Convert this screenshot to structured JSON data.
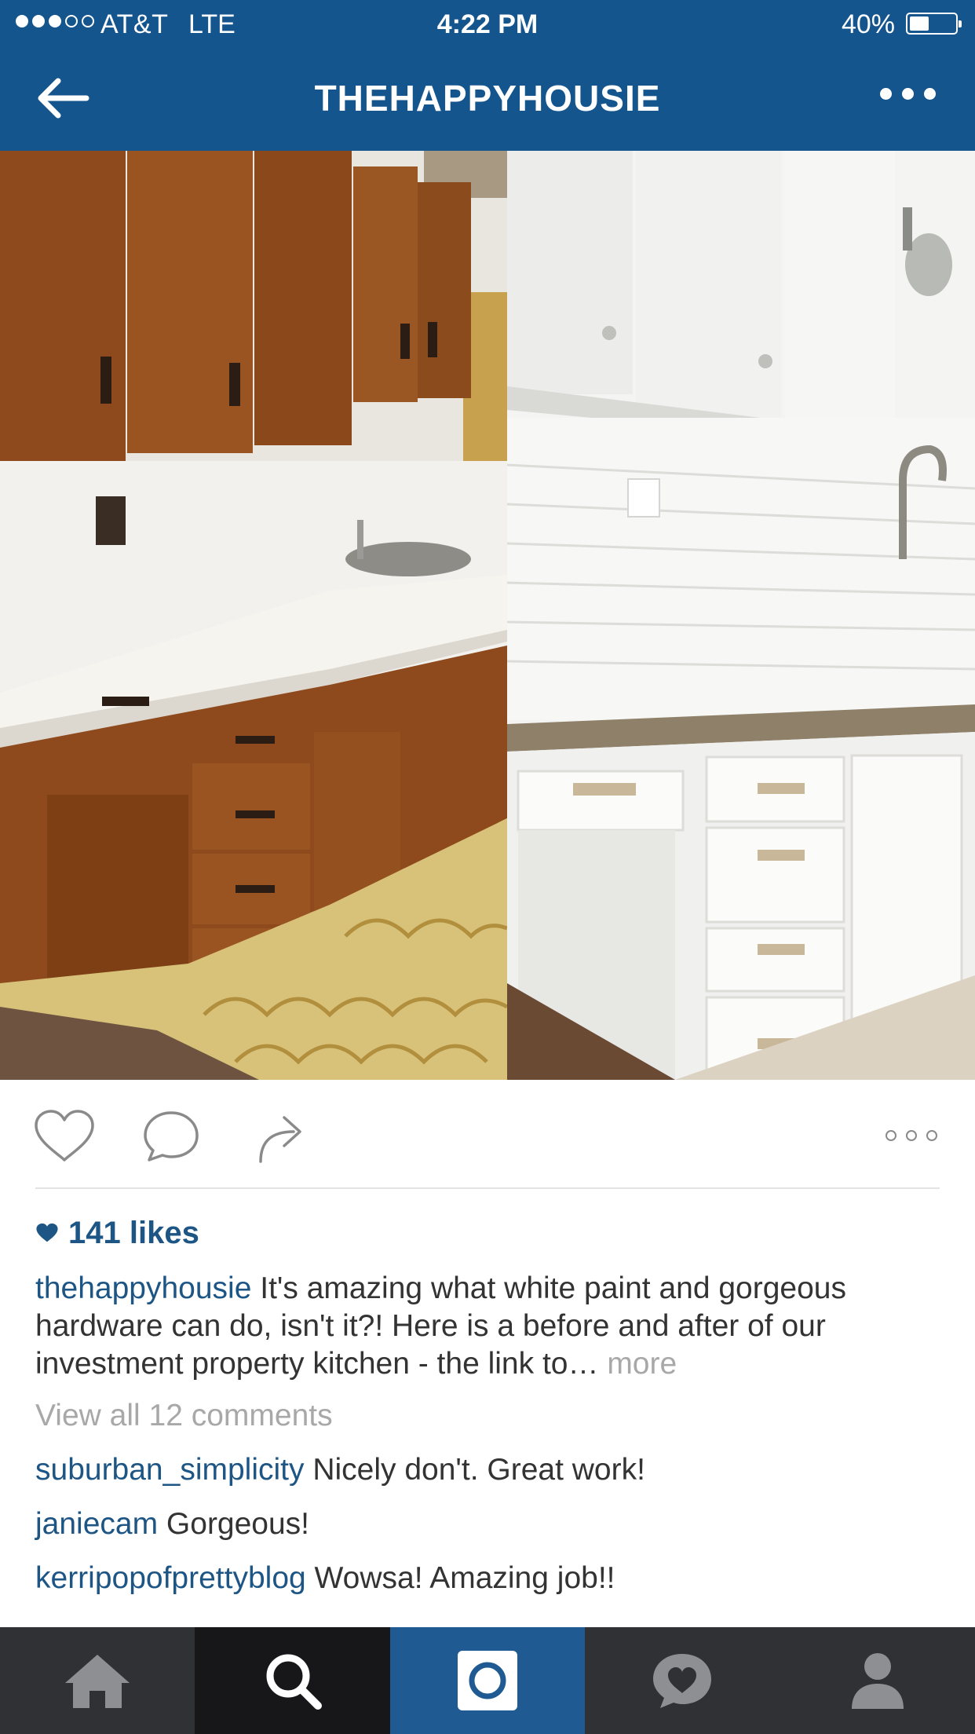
{
  "status_bar": {
    "carrier": "AT&T",
    "network": "LTE",
    "time": "4:22 PM",
    "battery": "40%",
    "battery_level": 0.4,
    "signal_bars_filled": 3,
    "signal_bars_total": 5
  },
  "nav": {
    "title": "THEHAPPYHOUSIE",
    "back_icon": "back-arrow-icon",
    "more_icon": "more-dots-icon"
  },
  "post": {
    "image_alt_icon": "kitchen-before-after-photo",
    "likes": "141 likes",
    "caption_user": "thehappyhousie",
    "caption_text": " It's amazing what white paint and gorgeous hardware can do, isn't it?! Here is a before and after of our investment property kitchen - the link to…",
    "caption_more": " more",
    "view_all": "View all 12 comments",
    "comments": [
      {
        "user": "suburban_simplicity",
        "text": " Nicely don't. Great work!"
      },
      {
        "user": "janiecam",
        "text": " Gorgeous!"
      },
      {
        "user": "kerripopofprettyblog",
        "text": " Wowsa! Amazing job!!"
      }
    ]
  },
  "colors": {
    "header": "#15558e",
    "username": "#1d5585",
    "muted": "#a8a8a8",
    "tabbar": "#303134",
    "tab_active": "#1f5b92"
  },
  "tabs": [
    {
      "icon": "home-icon"
    },
    {
      "icon": "search-icon"
    },
    {
      "icon": "camera-icon"
    },
    {
      "icon": "activity-heart-icon"
    },
    {
      "icon": "profile-icon"
    }
  ]
}
